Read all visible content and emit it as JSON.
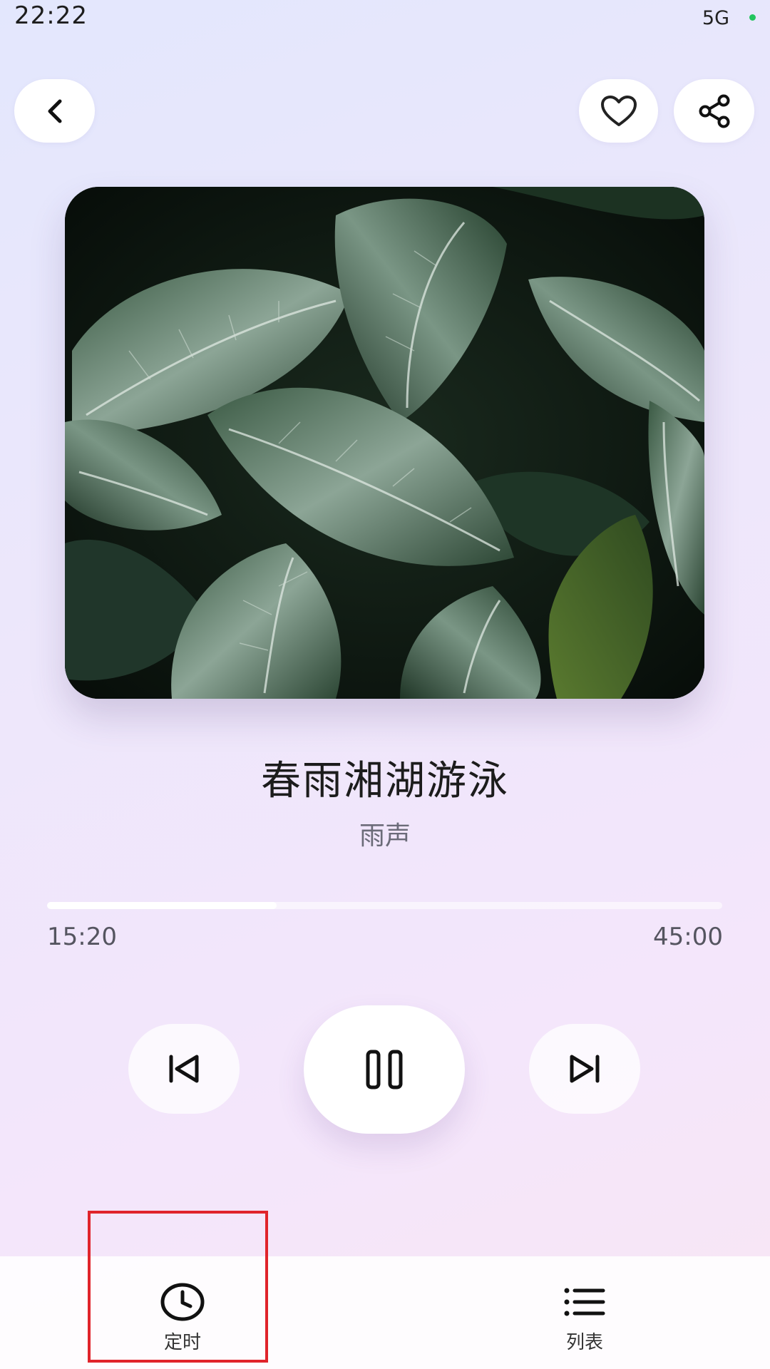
{
  "status_bar": {
    "time": "22:22",
    "network": "5G",
    "dot_color": "#22c55e"
  },
  "header": {
    "back_icon": "chevron-left-icon",
    "favorite_icon": "heart-icon",
    "share_icon": "share-icon"
  },
  "player": {
    "title": "春雨湘湖游泳",
    "artist": "雨声",
    "current_time": "15:20",
    "total_time": "45:00",
    "progress_fraction": 0.34,
    "state": "playing"
  },
  "controls": {
    "prev_icon": "skip-previous-icon",
    "play_pause_icon": "pause-icon",
    "next_icon": "skip-next-icon"
  },
  "bottom_bar": {
    "timer_label": "定时",
    "timer_icon": "clock-icon",
    "list_label": "列表",
    "list_icon": "list-icon"
  },
  "colors": {
    "highlight": "#e0242b",
    "accent": "#ffffff"
  }
}
